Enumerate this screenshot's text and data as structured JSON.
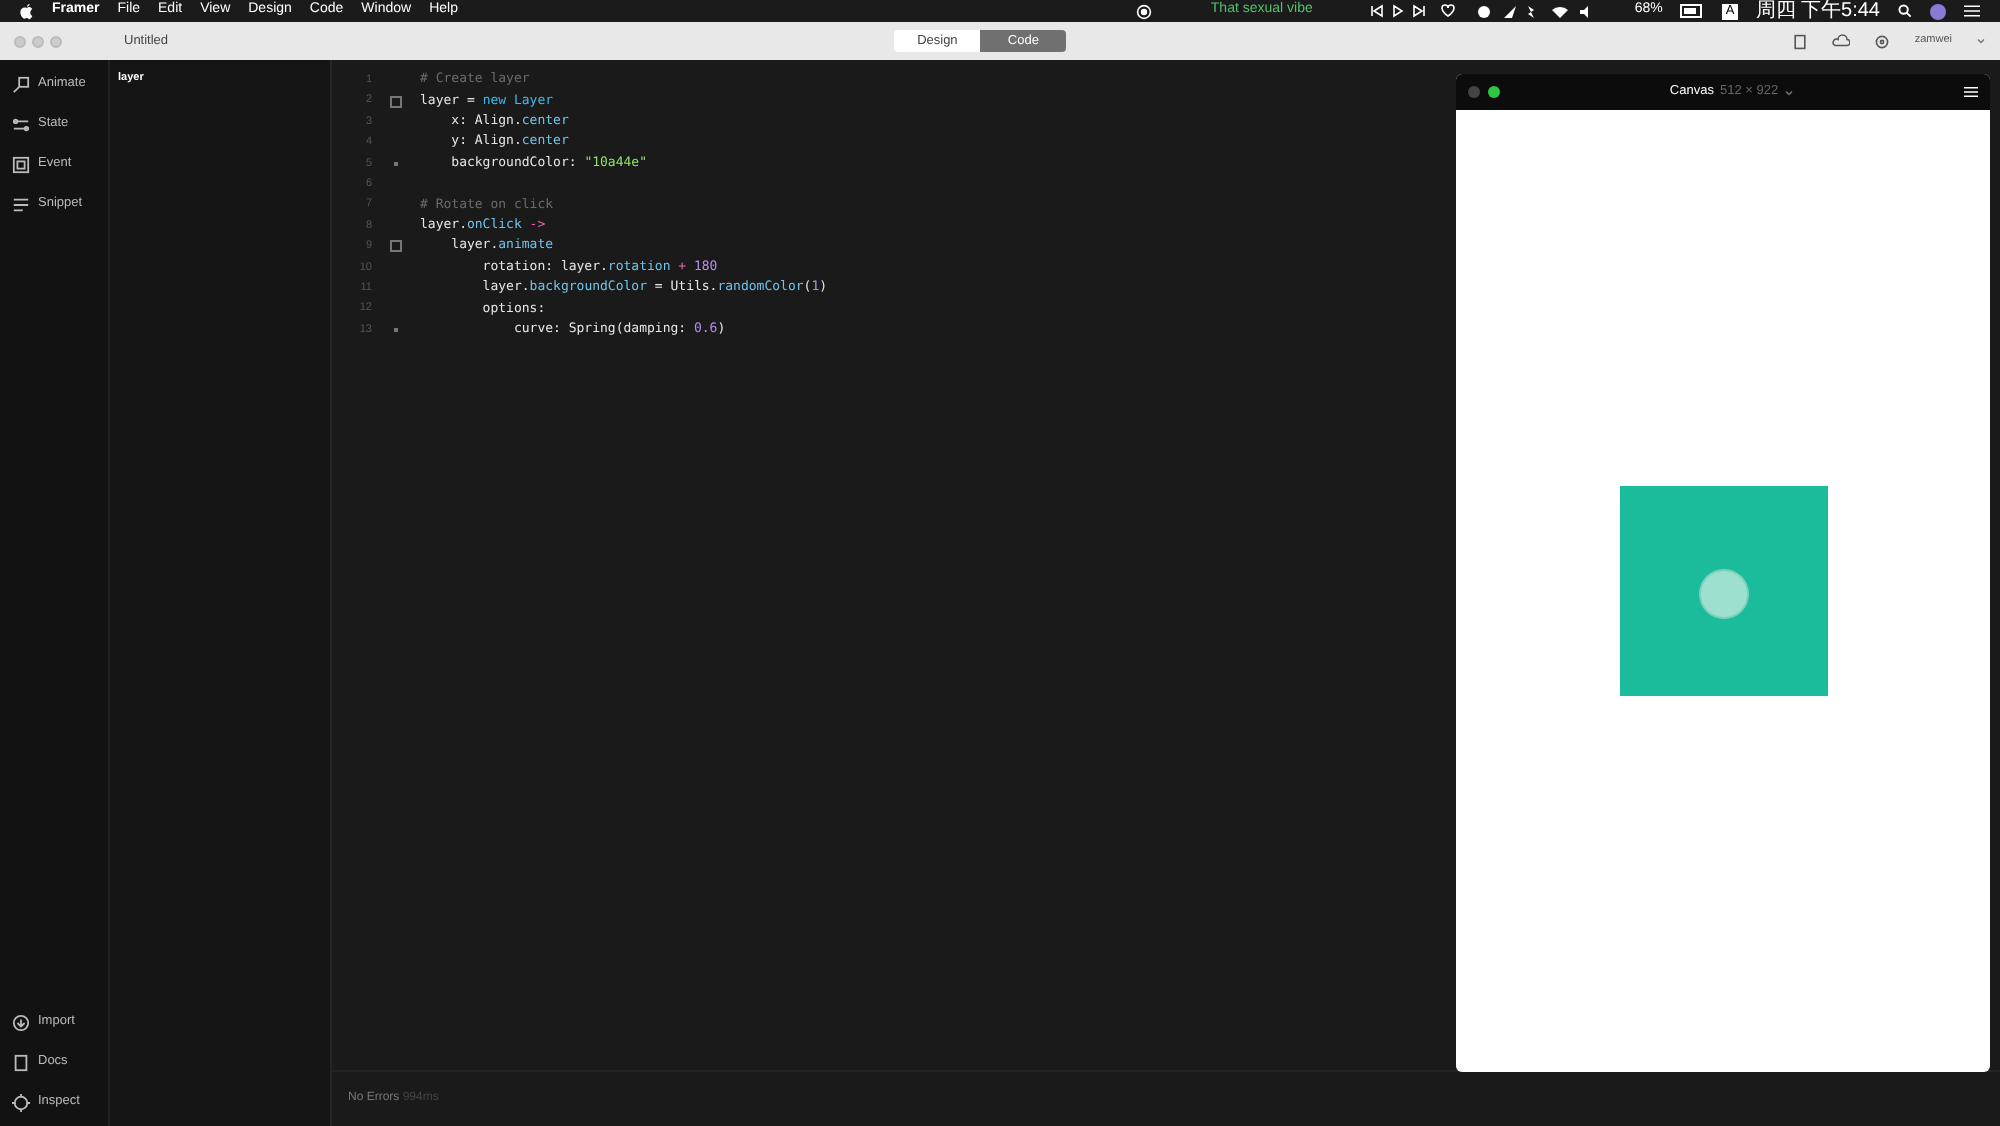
{
  "menu_bar": {
    "app": "Framer",
    "items": [
      "File",
      "Edit",
      "View",
      "Design",
      "Code",
      "Window",
      "Help"
    ],
    "now_playing": "That sexual vibe",
    "battery": "68%",
    "input_source": "A",
    "clock": "周四 下午5:44"
  },
  "window": {
    "title": "Untitled",
    "modes": [
      {
        "label": "Design",
        "selected": false
      },
      {
        "label": "Code",
        "selected": true
      }
    ],
    "user": "zamwei"
  },
  "sidebar": {
    "items": [
      {
        "label": "Animate",
        "kind": "animate"
      },
      {
        "label": "State",
        "kind": "state"
      },
      {
        "label": "Event",
        "kind": "event"
      },
      {
        "label": "Snippet",
        "kind": "snippet"
      }
    ],
    "bottom_items": [
      {
        "label": "Import",
        "kind": "import"
      },
      {
        "label": "Docs",
        "kind": "docs"
      },
      {
        "label": "Inspect",
        "kind": "inspect"
      }
    ]
  },
  "layers": [
    "layer"
  ],
  "code": [
    {
      "number": "1",
      "foldable": false,
      "block_end": false,
      "tokens": [
        {
          "text": "# Create layer",
          "kind": "comment"
        }
      ]
    },
    {
      "number": "2",
      "foldable": true,
      "block_end": false,
      "tokens": [
        {
          "text": "layer = ",
          "kind": "plain"
        },
        {
          "text": "new Layer",
          "kind": "keyword"
        }
      ]
    },
    {
      "number": "3",
      "foldable": false,
      "block_end": false,
      "tokens": [
        {
          "text": "    x: Align.",
          "kind": "plain"
        },
        {
          "text": "center",
          "kind": "prop"
        }
      ]
    },
    {
      "number": "4",
      "foldable": false,
      "block_end": false,
      "tokens": [
        {
          "text": "    y: Align.",
          "kind": "plain"
        },
        {
          "text": "center",
          "kind": "prop"
        }
      ]
    },
    {
      "number": "5",
      "foldable": false,
      "block_end": true,
      "tokens": [
        {
          "text": "    backgroundColor: ",
          "kind": "plain"
        },
        {
          "text": "\"10a44e\"",
          "kind": "string"
        }
      ]
    },
    {
      "number": "6",
      "foldable": false,
      "block_end": false
    },
    {
      "number": "7",
      "foldable": false,
      "block_end": false,
      "tokens": [
        {
          "text": "# Rotate on click",
          "kind": "comment"
        }
      ]
    },
    {
      "number": "8",
      "foldable": false,
      "block_end": false,
      "tokens": [
        {
          "text": "layer.",
          "kind": "plain"
        },
        {
          "text": "onClick",
          "kind": "prop"
        },
        {
          "text": " ->",
          "kind": "op"
        }
      ]
    },
    {
      "number": "9",
      "foldable": true,
      "block_end": false,
      "tokens": [
        {
          "text": "    layer.",
          "kind": "plain"
        },
        {
          "text": "animate",
          "kind": "prop"
        }
      ]
    },
    {
      "number": "10",
      "foldable": false,
      "block_end": false,
      "tokens": [
        {
          "text": "        rotation: layer.",
          "kind": "plain"
        },
        {
          "text": "rotation",
          "kind": "prop"
        },
        {
          "text": " + ",
          "kind": "op"
        },
        {
          "text": "180",
          "kind": "number"
        }
      ]
    },
    {
      "number": "11",
      "foldable": false,
      "block_end": false,
      "tokens": [
        {
          "text": "        layer.",
          "kind": "plain"
        },
        {
          "text": "backgroundColor",
          "kind": "prop"
        },
        {
          "text": " = Utils.",
          "kind": "plain"
        },
        {
          "text": "randomColor",
          "kind": "prop"
        },
        {
          "text": "(",
          "kind": "plain"
        },
        {
          "text": "1",
          "kind": "number"
        },
        {
          "text": ")",
          "kind": "plain"
        }
      ]
    },
    {
      "number": "12",
      "foldable": false,
      "block_end": false,
      "tokens": [
        {
          "text": "        options:",
          "kind": "plain"
        }
      ]
    },
    {
      "number": "13",
      "foldable": false,
      "block_end": true,
      "tokens": [
        {
          "text": "            curve: Spring(damping: ",
          "kind": "plain"
        },
        {
          "text": "0.6",
          "kind": "number"
        },
        {
          "text": ")",
          "kind": "plain"
        }
      ]
    }
  ],
  "status": {
    "message": "No Errors",
    "time": "994ms"
  },
  "preview": {
    "title": "Canvas",
    "size": "512 × 922"
  }
}
